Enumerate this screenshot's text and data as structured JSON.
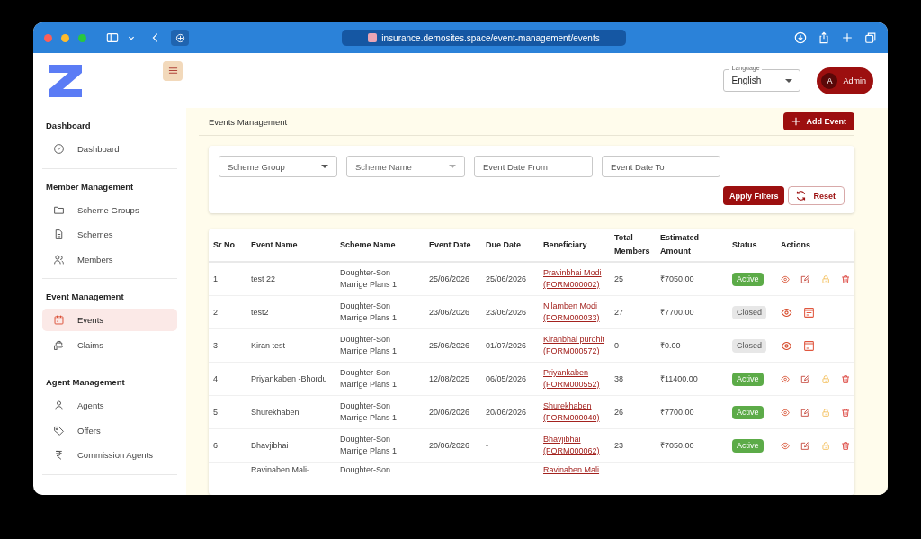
{
  "browser": {
    "url": "insurance.demosites.space/event-management/events"
  },
  "header": {
    "language": {
      "label": "Language",
      "value": "English"
    },
    "user": {
      "initial": "A",
      "name": "Admin"
    }
  },
  "sidebar": {
    "sections": [
      {
        "title": "Dashboard",
        "items": [
          {
            "label": "Dashboard",
            "selected": false
          }
        ]
      },
      {
        "title": "Member Management",
        "items": [
          {
            "label": "Scheme Groups",
            "selected": false
          },
          {
            "label": "Schemes",
            "selected": false
          },
          {
            "label": "Members",
            "selected": false
          }
        ]
      },
      {
        "title": "Event Management",
        "items": [
          {
            "label": "Events",
            "selected": true
          },
          {
            "label": "Claims",
            "selected": false
          }
        ]
      },
      {
        "title": "Agent Management",
        "items": [
          {
            "label": "Agents",
            "selected": false
          },
          {
            "label": "Offers",
            "selected": false
          },
          {
            "label": "Commission Agents",
            "selected": false
          }
        ]
      }
    ]
  },
  "page": {
    "title": "Events Management",
    "add_button": "Add Event"
  },
  "filters": {
    "fields": [
      {
        "kind": "select",
        "placeholder": "Scheme Group",
        "disabled": false
      },
      {
        "kind": "select",
        "placeholder": "Scheme Name",
        "disabled": true
      },
      {
        "kind": "text",
        "placeholder": "Event Date From"
      },
      {
        "kind": "text",
        "placeholder": "Event Date To"
      }
    ],
    "apply": "Apply Filters",
    "reset": "Reset"
  },
  "table": {
    "columns": [
      "Sr No",
      "Event Name",
      "Scheme Name",
      "Event Date",
      "Due Date",
      "Beneficiary",
      "Total Members",
      "Estimated Amount",
      "Status",
      "Actions"
    ],
    "rows": [
      {
        "sr": "1",
        "event": "test 22",
        "scheme": "Doughter-Son Marrige Plans 1",
        "event_date": "25/06/2026",
        "due_date": "25/06/2026",
        "beneficiary": "Pravinbhai Modi (FORM000002)",
        "members": "25",
        "amount": "₹7050.00",
        "status": {
          "kind": "active",
          "label": "Active"
        }
      },
      {
        "sr": "2",
        "event": "test2",
        "scheme": "Doughter-Son Marrige Plans 1",
        "event_date": "23/06/2026",
        "due_date": "23/06/2026",
        "beneficiary": "Nilamben Modi (FORM000033)",
        "members": "27",
        "amount": "₹7700.00",
        "status": {
          "kind": "closed",
          "label": "Closed"
        }
      },
      {
        "sr": "3",
        "event": "Kiran test",
        "scheme": "Doughter-Son Marrige Plans 1",
        "event_date": "25/06/2026",
        "due_date": "01/07/2026",
        "beneficiary": "Kiranbhai purohit (FORM000572)",
        "members": "0",
        "amount": "₹0.00",
        "status": {
          "kind": "closed",
          "label": "Closed"
        }
      },
      {
        "sr": "4",
        "event": "Priyankaben -Bhordu",
        "scheme": "Doughter-Son Marrige Plans 1",
        "event_date": "12/08/2025",
        "due_date": "06/05/2026",
        "beneficiary": "Priyankaben (FORM000552)",
        "members": "38",
        "amount": "₹11400.00",
        "status": {
          "kind": "active",
          "label": "Active"
        }
      },
      {
        "sr": "5",
        "event": "Shurekhaben",
        "scheme": "Doughter-Son Marrige Plans 1",
        "event_date": "20/06/2026",
        "due_date": "20/06/2026",
        "beneficiary": "Shurekhaben (FORM000040)",
        "members": "26",
        "amount": "₹7700.00",
        "status": {
          "kind": "active",
          "label": "Active"
        }
      },
      {
        "sr": "6",
        "event": "Bhavjibhai",
        "scheme": "Doughter-Son Marrige Plans 1",
        "event_date": "20/06/2026",
        "due_date": "-",
        "beneficiary": "Bhavjibhai (FORM000062)",
        "members": "23",
        "amount": "₹7050.00",
        "status": {
          "kind": "active",
          "label": "Active"
        }
      },
      {
        "event": "Ravinaben Mali-",
        "scheme": "Doughter-Son",
        "beneficiary": "Ravinaben Mali"
      }
    ]
  }
}
